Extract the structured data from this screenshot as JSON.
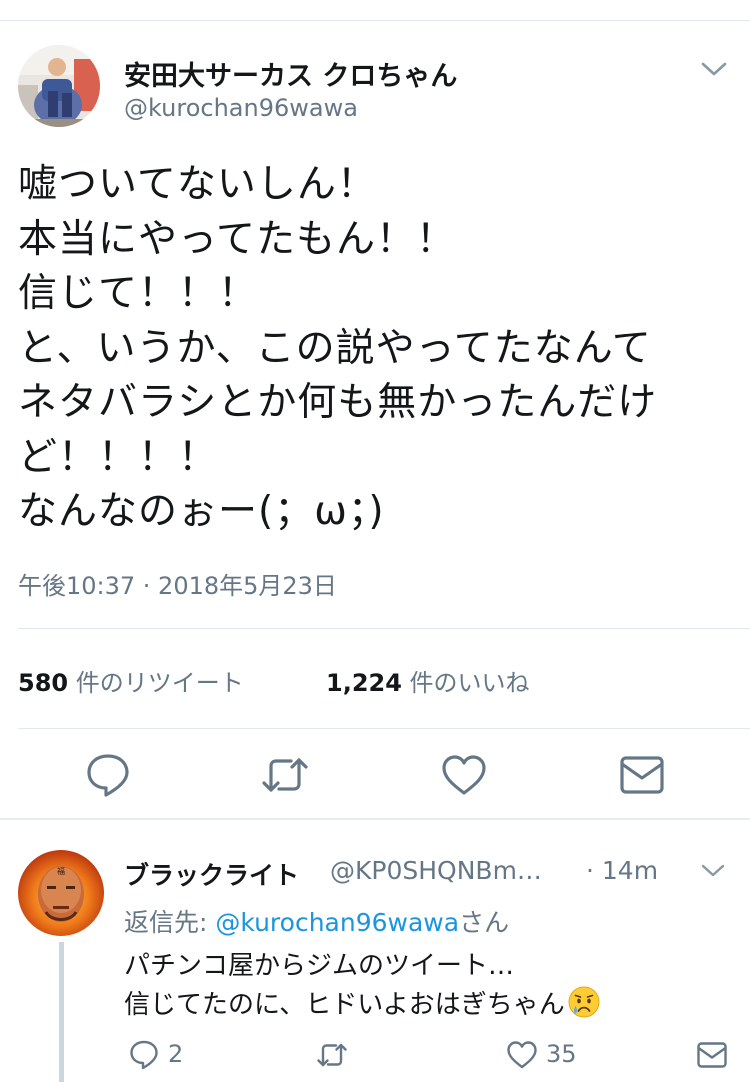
{
  "main_tweet": {
    "display_name": "安田大サーカス クロちゃん",
    "handle": "@kurochan96wawa",
    "text_lines": [
      "嘘ついてないしん！",
      "本当にやってたもん！！",
      "信じて！！！",
      "と、いうか、この説やってたなんて",
      "ネタバラシとか何も無かったんだけ",
      "ど！！！！",
      "なんなのぉー(；ω；)"
    ],
    "timestamp": "午後10:37 · 2018年5月23日",
    "retweets": {
      "count": "580",
      "label": " 件のリツイート"
    },
    "likes": {
      "count": "1,224",
      "label": " 件のいいね"
    },
    "icons": [
      "chevron-down-icon",
      "reply-icon",
      "retweet-icon",
      "like-icon",
      "message-icon"
    ]
  },
  "reply_tweet": {
    "display_name": "ブラックライト",
    "handle": "@KP0SHQNBm…",
    "time": "· 14m",
    "reply_to_label": "返信先: ",
    "reply_to_mention": "@kurochan96wawa",
    "reply_to_suffix": "さん",
    "text_lines": [
      "パチンコ屋からジムのツイート…",
      "信じてたのに、ヒドいよおはぎちゃん"
    ],
    "emoji": "crying-face-icon",
    "reply_count": "2",
    "like_count": "35",
    "icons": [
      "chevron-down-icon",
      "reply-icon",
      "retweet-icon",
      "like-icon",
      "message-icon"
    ]
  },
  "colors": {
    "text": "#14171a",
    "muted": "#657786",
    "link": "#1b95e0",
    "divider": "#e1e8ed"
  }
}
